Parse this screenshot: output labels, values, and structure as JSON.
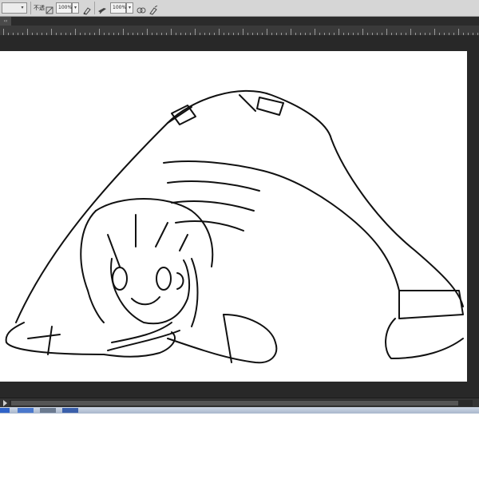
{
  "options_bar": {
    "opacity_label": "不透",
    "opacity_value": "100%",
    "flow_label": "流",
    "flow_value": "100%"
  },
  "colors": {
    "panel_bg": "#d6d6d6",
    "workspace_bg": "#282828",
    "canvas_bg": "#ffffff",
    "line_art": "#111111"
  },
  "icons": [
    "brush-preset-icon",
    "mode-dropdown-icon",
    "airbrush-icon",
    "pressure-opacity-icon",
    "pressure-size-icon"
  ]
}
